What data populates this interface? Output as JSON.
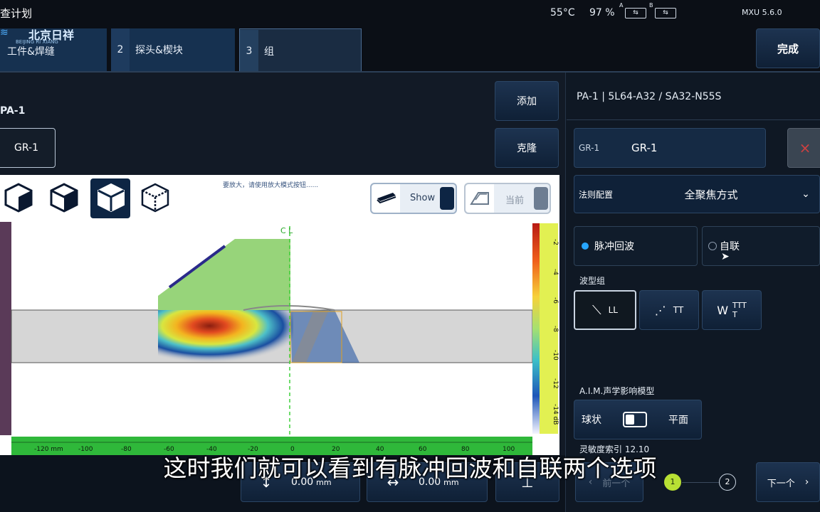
{
  "status": {
    "title": "查计划",
    "temp": "55°C",
    "battery": "97 %",
    "slot_a": "A",
    "slot_b": "B",
    "version": "MXU 5.6.0"
  },
  "logo": {
    "text": "北京日祥",
    "sub": "BEIJING RI XIANG"
  },
  "tabs": [
    {
      "num": "",
      "label": "工件&焊缝"
    },
    {
      "num": "2",
      "label": "探头&楔块"
    },
    {
      "num": "3",
      "label": "组"
    }
  ],
  "finish_label": "完成",
  "left": {
    "group_name": "PA-1",
    "gr_button": "GR-1",
    "add_label": "添加",
    "clone_label": "克隆"
  },
  "viewer": {
    "zoom_hint": "要放大，请使用放大模式按钮......",
    "show_label": "Show",
    "current_label": "当前",
    "cl_label": "C L",
    "scale_ticks": [
      "-2",
      "-4",
      "-6",
      "-8",
      "-10",
      "-12",
      "-14 dB"
    ],
    "ruler_ticks": [
      "-120 mm",
      "-100",
      "-80",
      "-60",
      "-40",
      "-20",
      "0",
      "20",
      "40",
      "60",
      "80",
      "100"
    ]
  },
  "right": {
    "probe_title": "PA-1 | 5L64-A32 / SA32-N55S",
    "gr_label": "GR-1",
    "gr_value": "GR-1",
    "close_icon": "×",
    "law_label": "法则配置",
    "law_value": "全聚焦方式",
    "pulse_echo": "脉冲回波",
    "self_tandem": "自联",
    "wave_group_label": "波型组",
    "waves": [
      {
        "label": "LL"
      },
      {
        "label": "TT"
      },
      {
        "label": "TTT\nT"
      }
    ],
    "aim_label": "A.I.M.声学影响模型",
    "sphere_label": "球状",
    "plane_label": "平面",
    "sensitivity": "灵敏度索引  12.10",
    "prev_label": "前一个",
    "step1": "1",
    "step2": "2",
    "next_label": "下一个"
  },
  "bottom": {
    "val1": "0.00",
    "unit1": "mm",
    "val2": "0.00",
    "unit2": "mm"
  },
  "subtitle": "这时我们就可以看到有脉冲回波和自联两个选项",
  "colors": {
    "accent": "#1a6fd0",
    "panel": "#0f1a28",
    "green": "#97d47a"
  }
}
